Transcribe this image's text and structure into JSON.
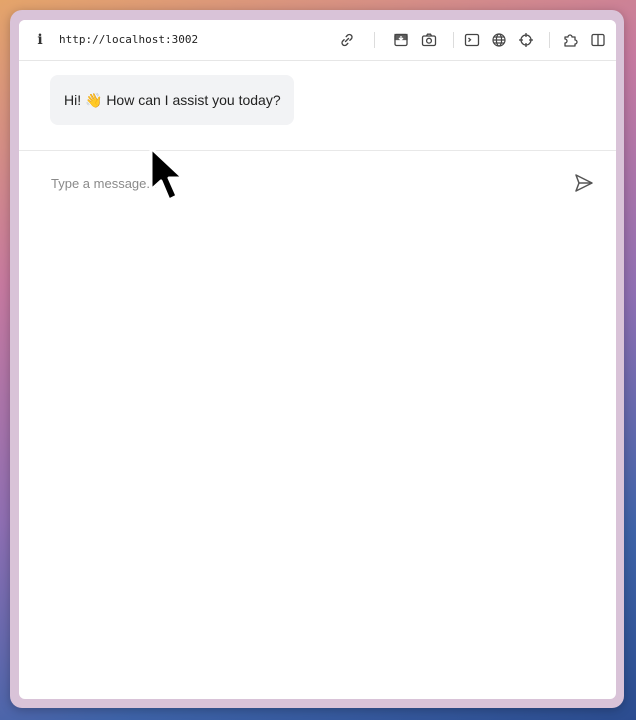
{
  "toolbar": {
    "info_icon": "i",
    "url": "http://localhost:3002",
    "icons": [
      "link-icon",
      "download-icon",
      "camera-icon",
      "terminal-icon",
      "globe-icon",
      "crosshair-icon",
      "puzzle-icon",
      "sidebar-icon"
    ]
  },
  "chat": {
    "messages": [
      {
        "role": "assistant",
        "text": "Hi! 👋 How can I assist you today?"
      }
    ]
  },
  "composer": {
    "placeholder": "Type a message...",
    "value": ""
  },
  "colors": {
    "bubble": "#f2f3f5",
    "window": "#ffffff",
    "frame": "#d9c3d8"
  }
}
